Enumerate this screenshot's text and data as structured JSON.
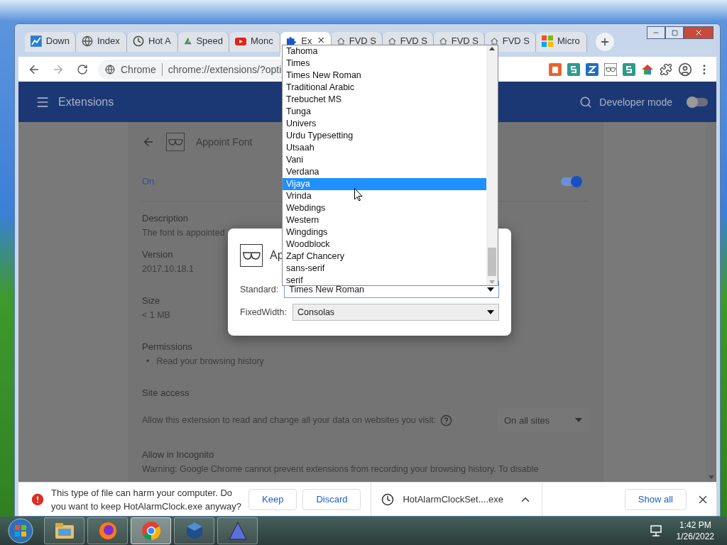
{
  "browser": {
    "tabs": [
      {
        "label": "Down",
        "kind": "chart",
        "selected": false
      },
      {
        "label": "Index",
        "kind": "globe",
        "selected": false
      },
      {
        "label": "Hot A",
        "kind": "clock",
        "selected": false
      },
      {
        "label": "Speed",
        "kind": "drive",
        "selected": false
      },
      {
        "label": "Monc",
        "kind": "video",
        "selected": false
      },
      {
        "label": "Ex",
        "kind": "puzzle",
        "selected": true
      },
      {
        "label": "FVD S",
        "kind": "house",
        "selected": false
      },
      {
        "label": "FVD S",
        "kind": "house",
        "selected": false
      },
      {
        "label": "FVD S",
        "kind": "house",
        "selected": false
      },
      {
        "label": "FVD S",
        "kind": "house",
        "selected": false
      },
      {
        "label": "Micro",
        "kind": "windows",
        "selected": false
      }
    ],
    "address": {
      "site_label": "Chrome",
      "url": "chrome://extensions/?opti"
    }
  },
  "extensions_header": {
    "title": "Extensions",
    "developer_mode": {
      "label": "Developer mode",
      "on": false
    }
  },
  "detail": {
    "name": "Appoint Font",
    "status": {
      "label": "On",
      "on": true
    },
    "sections": [
      {
        "kind": "text",
        "heading": "Description",
        "text": "The font is appointed"
      },
      {
        "kind": "text",
        "heading": "Version",
        "text": "2017.10.18.1"
      },
      {
        "kind": "text",
        "heading": "Size",
        "text": "< 1 MB"
      },
      {
        "kind": "bullets",
        "heading": "Permissions",
        "marker": "•",
        "items": [
          "Read your browsing history"
        ]
      },
      {
        "kind": "select",
        "heading": "Site access",
        "text": "Allow this extension to read and change all your data on websites you visit:",
        "value": "On all sites"
      },
      {
        "kind": "text",
        "heading": "Allow in Incognito",
        "text": "Warning: Google Chrome cannot prevent extensions from recording your browsing history. To disable"
      }
    ]
  },
  "dialog": {
    "title": "Ap",
    "fields": [
      {
        "label": "Standard:",
        "value": "Times New Roman",
        "focused": true
      },
      {
        "label": "FixedWidth:",
        "value": "Consolas",
        "focused": false
      }
    ]
  },
  "font_list": {
    "items": [
      {
        "label": "Tahoma",
        "selected": false
      },
      {
        "label": "Times",
        "selected": false
      },
      {
        "label": "Times New Roman",
        "selected": false
      },
      {
        "label": "Traditional Arabic",
        "selected": false
      },
      {
        "label": "Trebuchet MS",
        "selected": false
      },
      {
        "label": "Tunga",
        "selected": false
      },
      {
        "label": "Univers",
        "selected": false
      },
      {
        "label": "Urdu Typesetting",
        "selected": false
      },
      {
        "label": "Utsaah",
        "selected": false
      },
      {
        "label": "Vani",
        "selected": false
      },
      {
        "label": "Verdana",
        "selected": false
      },
      {
        "label": "Vijaya",
        "selected": true
      },
      {
        "label": "Vrinda",
        "selected": false
      },
      {
        "label": "Webdings",
        "selected": false
      },
      {
        "label": "Western",
        "selected": false
      },
      {
        "label": "Wingdings",
        "selected": false
      },
      {
        "label": "Woodblock",
        "selected": false
      },
      {
        "label": "Zapf Chancery",
        "selected": false
      },
      {
        "label": "sans-serif",
        "selected": false
      },
      {
        "label": "serif",
        "selected": false
      }
    ]
  },
  "download_bar": {
    "message": "This type of file can harm your computer. Do you want to keep HotAlarmClock.exe anyway?",
    "buttons": [
      "Keep",
      "Discard"
    ],
    "file": "HotAlarmClockSet....exe",
    "show_all": "Show all"
  },
  "taskbar": {
    "apps": [
      {
        "kind": "explorer",
        "active": false
      },
      {
        "kind": "firefox",
        "active": false
      },
      {
        "kind": "chrome",
        "active": true
      },
      {
        "kind": "cube",
        "active": false
      },
      {
        "kind": "triangle",
        "active": false
      }
    ],
    "time": "1:42 PM",
    "date": "1/26/2022"
  }
}
